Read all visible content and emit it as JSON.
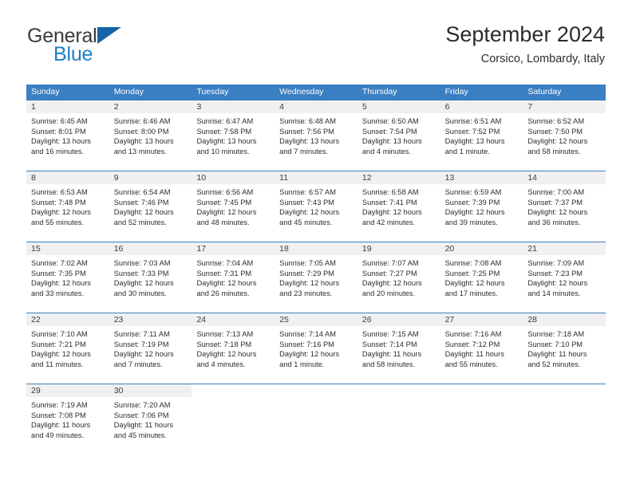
{
  "brand": {
    "name_part1": "General",
    "name_part2": "Blue",
    "accent_color": "#1c7fc4",
    "triangle_color": "#1565a6",
    "icon": "triangle-flag-icon"
  },
  "header": {
    "title": "September 2024",
    "location": "Corsico, Lombardy, Italy"
  },
  "calendar": {
    "header_bg": "#3a7fc1",
    "daynum_bg": "#f0f0f0",
    "weekdays": [
      "Sunday",
      "Monday",
      "Tuesday",
      "Wednesday",
      "Thursday",
      "Friday",
      "Saturday"
    ],
    "weeks": [
      [
        {
          "day": "1",
          "sunrise": "Sunrise: 6:45 AM",
          "sunset": "Sunset: 8:01 PM",
          "daylight1": "Daylight: 13 hours",
          "daylight2": "and 16 minutes."
        },
        {
          "day": "2",
          "sunrise": "Sunrise: 6:46 AM",
          "sunset": "Sunset: 8:00 PM",
          "daylight1": "Daylight: 13 hours",
          "daylight2": "and 13 minutes."
        },
        {
          "day": "3",
          "sunrise": "Sunrise: 6:47 AM",
          "sunset": "Sunset: 7:58 PM",
          "daylight1": "Daylight: 13 hours",
          "daylight2": "and 10 minutes."
        },
        {
          "day": "4",
          "sunrise": "Sunrise: 6:48 AM",
          "sunset": "Sunset: 7:56 PM",
          "daylight1": "Daylight: 13 hours",
          "daylight2": "and 7 minutes."
        },
        {
          "day": "5",
          "sunrise": "Sunrise: 6:50 AM",
          "sunset": "Sunset: 7:54 PM",
          "daylight1": "Daylight: 13 hours",
          "daylight2": "and 4 minutes."
        },
        {
          "day": "6",
          "sunrise": "Sunrise: 6:51 AM",
          "sunset": "Sunset: 7:52 PM",
          "daylight1": "Daylight: 13 hours",
          "daylight2": "and 1 minute."
        },
        {
          "day": "7",
          "sunrise": "Sunrise: 6:52 AM",
          "sunset": "Sunset: 7:50 PM",
          "daylight1": "Daylight: 12 hours",
          "daylight2": "and 58 minutes."
        }
      ],
      [
        {
          "day": "8",
          "sunrise": "Sunrise: 6:53 AM",
          "sunset": "Sunset: 7:48 PM",
          "daylight1": "Daylight: 12 hours",
          "daylight2": "and 55 minutes."
        },
        {
          "day": "9",
          "sunrise": "Sunrise: 6:54 AM",
          "sunset": "Sunset: 7:46 PM",
          "daylight1": "Daylight: 12 hours",
          "daylight2": "and 52 minutes."
        },
        {
          "day": "10",
          "sunrise": "Sunrise: 6:56 AM",
          "sunset": "Sunset: 7:45 PM",
          "daylight1": "Daylight: 12 hours",
          "daylight2": "and 48 minutes."
        },
        {
          "day": "11",
          "sunrise": "Sunrise: 6:57 AM",
          "sunset": "Sunset: 7:43 PM",
          "daylight1": "Daylight: 12 hours",
          "daylight2": "and 45 minutes."
        },
        {
          "day": "12",
          "sunrise": "Sunrise: 6:58 AM",
          "sunset": "Sunset: 7:41 PM",
          "daylight1": "Daylight: 12 hours",
          "daylight2": "and 42 minutes."
        },
        {
          "day": "13",
          "sunrise": "Sunrise: 6:59 AM",
          "sunset": "Sunset: 7:39 PM",
          "daylight1": "Daylight: 12 hours",
          "daylight2": "and 39 minutes."
        },
        {
          "day": "14",
          "sunrise": "Sunrise: 7:00 AM",
          "sunset": "Sunset: 7:37 PM",
          "daylight1": "Daylight: 12 hours",
          "daylight2": "and 36 minutes."
        }
      ],
      [
        {
          "day": "15",
          "sunrise": "Sunrise: 7:02 AM",
          "sunset": "Sunset: 7:35 PM",
          "daylight1": "Daylight: 12 hours",
          "daylight2": "and 33 minutes."
        },
        {
          "day": "16",
          "sunrise": "Sunrise: 7:03 AM",
          "sunset": "Sunset: 7:33 PM",
          "daylight1": "Daylight: 12 hours",
          "daylight2": "and 30 minutes."
        },
        {
          "day": "17",
          "sunrise": "Sunrise: 7:04 AM",
          "sunset": "Sunset: 7:31 PM",
          "daylight1": "Daylight: 12 hours",
          "daylight2": "and 26 minutes."
        },
        {
          "day": "18",
          "sunrise": "Sunrise: 7:05 AM",
          "sunset": "Sunset: 7:29 PM",
          "daylight1": "Daylight: 12 hours",
          "daylight2": "and 23 minutes."
        },
        {
          "day": "19",
          "sunrise": "Sunrise: 7:07 AM",
          "sunset": "Sunset: 7:27 PM",
          "daylight1": "Daylight: 12 hours",
          "daylight2": "and 20 minutes."
        },
        {
          "day": "20",
          "sunrise": "Sunrise: 7:08 AM",
          "sunset": "Sunset: 7:25 PM",
          "daylight1": "Daylight: 12 hours",
          "daylight2": "and 17 minutes."
        },
        {
          "day": "21",
          "sunrise": "Sunrise: 7:09 AM",
          "sunset": "Sunset: 7:23 PM",
          "daylight1": "Daylight: 12 hours",
          "daylight2": "and 14 minutes."
        }
      ],
      [
        {
          "day": "22",
          "sunrise": "Sunrise: 7:10 AM",
          "sunset": "Sunset: 7:21 PM",
          "daylight1": "Daylight: 12 hours",
          "daylight2": "and 11 minutes."
        },
        {
          "day": "23",
          "sunrise": "Sunrise: 7:11 AM",
          "sunset": "Sunset: 7:19 PM",
          "daylight1": "Daylight: 12 hours",
          "daylight2": "and 7 minutes."
        },
        {
          "day": "24",
          "sunrise": "Sunrise: 7:13 AM",
          "sunset": "Sunset: 7:18 PM",
          "daylight1": "Daylight: 12 hours",
          "daylight2": "and 4 minutes."
        },
        {
          "day": "25",
          "sunrise": "Sunrise: 7:14 AM",
          "sunset": "Sunset: 7:16 PM",
          "daylight1": "Daylight: 12 hours",
          "daylight2": "and 1 minute."
        },
        {
          "day": "26",
          "sunrise": "Sunrise: 7:15 AM",
          "sunset": "Sunset: 7:14 PM",
          "daylight1": "Daylight: 11 hours",
          "daylight2": "and 58 minutes."
        },
        {
          "day": "27",
          "sunrise": "Sunrise: 7:16 AM",
          "sunset": "Sunset: 7:12 PM",
          "daylight1": "Daylight: 11 hours",
          "daylight2": "and 55 minutes."
        },
        {
          "day": "28",
          "sunrise": "Sunrise: 7:18 AM",
          "sunset": "Sunset: 7:10 PM",
          "daylight1": "Daylight: 11 hours",
          "daylight2": "and 52 minutes."
        }
      ],
      [
        {
          "day": "29",
          "sunrise": "Sunrise: 7:19 AM",
          "sunset": "Sunset: 7:08 PM",
          "daylight1": "Daylight: 11 hours",
          "daylight2": "and 49 minutes."
        },
        {
          "day": "30",
          "sunrise": "Sunrise: 7:20 AM",
          "sunset": "Sunset: 7:06 PM",
          "daylight1": "Daylight: 11 hours",
          "daylight2": "and 45 minutes."
        },
        {
          "day": "",
          "sunrise": "",
          "sunset": "",
          "daylight1": "",
          "daylight2": ""
        },
        {
          "day": "",
          "sunrise": "",
          "sunset": "",
          "daylight1": "",
          "daylight2": ""
        },
        {
          "day": "",
          "sunrise": "",
          "sunset": "",
          "daylight1": "",
          "daylight2": ""
        },
        {
          "day": "",
          "sunrise": "",
          "sunset": "",
          "daylight1": "",
          "daylight2": ""
        },
        {
          "day": "",
          "sunrise": "",
          "sunset": "",
          "daylight1": "",
          "daylight2": ""
        }
      ]
    ]
  }
}
